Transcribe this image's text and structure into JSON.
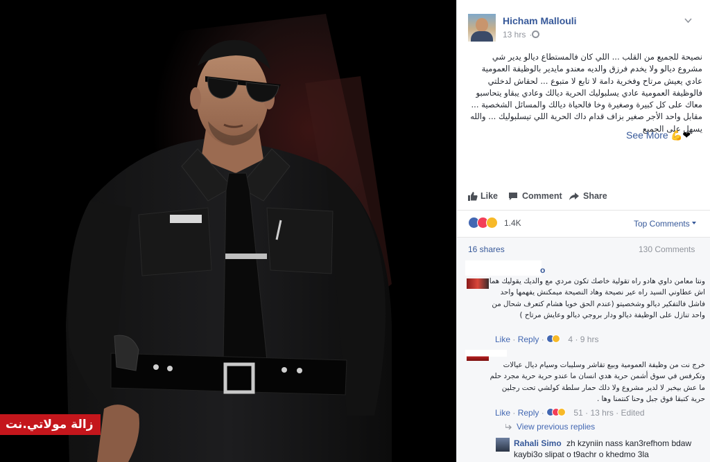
{
  "photo": {
    "watermark": "زالة مولاتي.نت"
  },
  "post": {
    "author": "Hicham Mallouli",
    "timestamp": "13 hrs",
    "text": "نصيحة للجميع من القلب ... اللي كان فالمستطاع ديالو يدير شي مشروع ديالو ولا يخدم فرزق والديه معندو مايدير بالوظيفة العمومية عادي يعيش مرتاح وفخرية دامة لا تابع لا متبوع ... لحقاش لدخلتي فالوظيفة العمومية عادي يسلبوليك الحرية ديالك وعادي يبقاو يتحاسبو معاك على كل كبيرة وصغيرة وخا فالحياة ديالك والمسائل الشخصية ... مقابل واحد الأجر صغير بزاف قدام داك الحرية اللي تيسلبوليك ... والله يسهل على الجميع",
    "see_more": "See More",
    "emoji": "💪❤"
  },
  "actions": {
    "like": "Like",
    "comment": "Comment",
    "share": "Share"
  },
  "reactions": {
    "count": "1.4K",
    "top_comments": "Top Comments"
  },
  "stats": {
    "shares": "16 shares",
    "comments": "130 Comments"
  },
  "comments": [
    {
      "name": "o",
      "text": "ونتا معامن داوي هادو راه تقولية خاصك تكون مردي مع والديك يقوليك هما اش عطاوني السيد راه عير نصيحة وهاد النصيحة ميمكنش يفهمها واحد فاشل فالتفكير ديالو وشخصيتو (عندم الحق خويا هشام كتعرف شحال من واحد تنازل على الوظيفة ديالو ودار بروجي ديالو وعايش مرتاح )",
      "like": "Like",
      "reply": "Reply",
      "reactions": "4",
      "time": "9 hrs"
    },
    {
      "name": "",
      "text": "خرج نت من وظيفة العمومية وبيع تقاشر وسليبات وسيام ديال عيالات وتكرفس في سوق أشمن حرية هدي انسان ما عندو حرية حرية مجرد حلم ما عش بيخبر لا لدير مشروع ولا دلك حمار سلطة كولشي تحت رجلين حرية كتبقا فوق جبل وحنا كنتمنا وها .",
      "like": "Like",
      "reply": "Reply",
      "reactions": "51",
      "time": "13 hrs",
      "edited": "Edited"
    }
  ],
  "view_previous": "View previous replies",
  "reply": {
    "name": "Rahali Simo",
    "text": "zh kzyniin nass kan3refhom bdaw kaybi3o slipat o t9achr o khedmo 3la"
  },
  "colors": {
    "link": "#365899",
    "accent": "#4267b2",
    "meta": "#90949c",
    "watermark_bg": "#c4161c"
  }
}
